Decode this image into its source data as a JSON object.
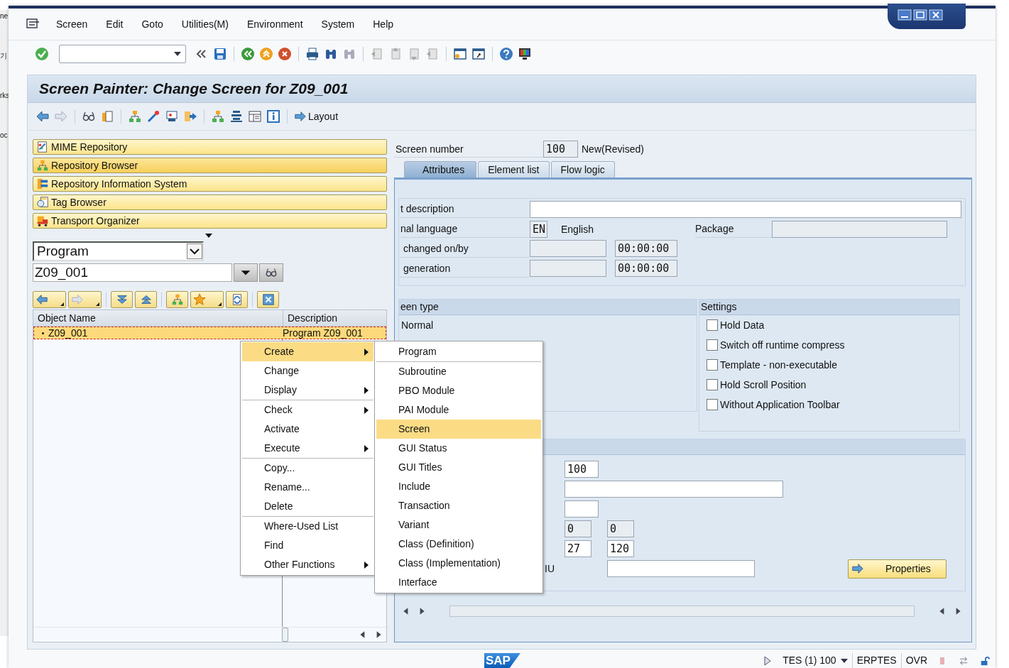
{
  "background": {
    "fragments": [
      "ne",
      "기",
      "rks",
      "oc"
    ]
  },
  "menu_bar": [
    "Screen",
    "Edit",
    "Goto",
    "Utilities(M)",
    "Environment",
    "System",
    "Help"
  ],
  "title": "Screen Painter: Change Screen for Z09_001",
  "app_toolbar": {
    "layout_button": "Layout"
  },
  "navigation": [
    {
      "label": "MIME Repository",
      "selected": false
    },
    {
      "label": "Repository Browser",
      "selected": true
    },
    {
      "label": "Repository Information System",
      "selected": false
    },
    {
      "label": "Tag Browser",
      "selected": false
    },
    {
      "label": "Transport Organizer",
      "selected": false
    }
  ],
  "object_type": {
    "value": "Program"
  },
  "object_name": {
    "value": "Z09_001"
  },
  "tree": {
    "columns": [
      "Object Name",
      "Description"
    ],
    "rows": [
      {
        "name": "Z09_001",
        "description": "Program Z09_001",
        "selected": true
      }
    ]
  },
  "context_menu": [
    {
      "label": "Create",
      "submenu": true,
      "separator_before": false,
      "selected": true
    },
    {
      "label": "Change",
      "submenu": false,
      "separator_before": false,
      "selected": false
    },
    {
      "label": "Display",
      "submenu": true,
      "separator_before": false,
      "selected": false
    },
    {
      "label": "Check",
      "submenu": true,
      "separator_before": true,
      "selected": false
    },
    {
      "label": "Activate",
      "submenu": false,
      "separator_before": false,
      "selected": false
    },
    {
      "label": "Execute",
      "submenu": true,
      "separator_before": false,
      "selected": false
    },
    {
      "label": "Copy...",
      "submenu": false,
      "separator_before": true,
      "selected": false
    },
    {
      "label": "Rename...",
      "submenu": false,
      "separator_before": false,
      "selected": false
    },
    {
      "label": "Delete",
      "submenu": false,
      "separator_before": false,
      "selected": false
    },
    {
      "label": "Where-Used List",
      "submenu": false,
      "separator_before": true,
      "selected": false
    },
    {
      "label": "Find",
      "submenu": false,
      "separator_before": false,
      "selected": false
    },
    {
      "label": "Other Functions",
      "submenu": true,
      "separator_before": false,
      "selected": false
    }
  ],
  "submenu": [
    {
      "label": "Program",
      "separator_before": false,
      "selected": false
    },
    {
      "label": "Subroutine",
      "separator_before": true,
      "selected": false
    },
    {
      "label": "PBO Module",
      "separator_before": false,
      "selected": false
    },
    {
      "label": "PAI Module",
      "separator_before": false,
      "selected": false
    },
    {
      "label": "Screen",
      "separator_before": false,
      "selected": true
    },
    {
      "label": "GUI Status",
      "separator_before": false,
      "selected": false
    },
    {
      "label": "GUI Titles",
      "separator_before": false,
      "selected": false
    },
    {
      "label": "Include",
      "separator_before": false,
      "selected": false
    },
    {
      "label": "Transaction",
      "separator_before": false,
      "selected": false
    },
    {
      "label": "Variant",
      "separator_before": false,
      "selected": false
    },
    {
      "label": "Class (Definition)",
      "separator_before": false,
      "selected": false
    },
    {
      "label": "Class (Implementation)",
      "separator_before": false,
      "selected": false
    },
    {
      "label": "Interface",
      "separator_before": false,
      "selected": false
    }
  ],
  "screen_number": {
    "label": "Screen number",
    "value": "100",
    "status": "New(Revised)"
  },
  "tabs": [
    {
      "label": "Attributes",
      "selected": true
    },
    {
      "label": "Element list",
      "selected": false
    },
    {
      "label": "Flow logic",
      "selected": false
    }
  ],
  "attributes": {
    "description_label": "t description",
    "language_label": "nal language",
    "language_code": "EN",
    "language_name": "English",
    "package_label": "Package",
    "changed_label": "changed on/by",
    "changed_time": "00:00:00",
    "generation_label": "generation",
    "generation_time": "00:00:00"
  },
  "screen_type": {
    "title": "een type",
    "value": "Normal"
  },
  "settings": {
    "title": "Settings",
    "options": [
      {
        "label": "Hold Data",
        "checked": false
      },
      {
        "label": "Switch off runtime compress",
        "checked": false
      },
      {
        "label": "Template - non-executable",
        "checked": false
      },
      {
        "label": "Hold Scroll Position",
        "checked": false
      },
      {
        "label": "Without Application Toolbar",
        "checked": false
      }
    ]
  },
  "other_attributes": {
    "next_screen": "100",
    "pairs": [
      {
        "values": [
          "0",
          "0"
        ],
        "disabled": true
      },
      {
        "values": [
          "27",
          "120"
        ],
        "disabled": false
      }
    ],
    "cut_label": "IU",
    "button": "Properties"
  },
  "status_bar": {
    "logo": "SAP",
    "session": "TES (1) 100",
    "server": "ERPTES",
    "mode": "OVR"
  }
}
